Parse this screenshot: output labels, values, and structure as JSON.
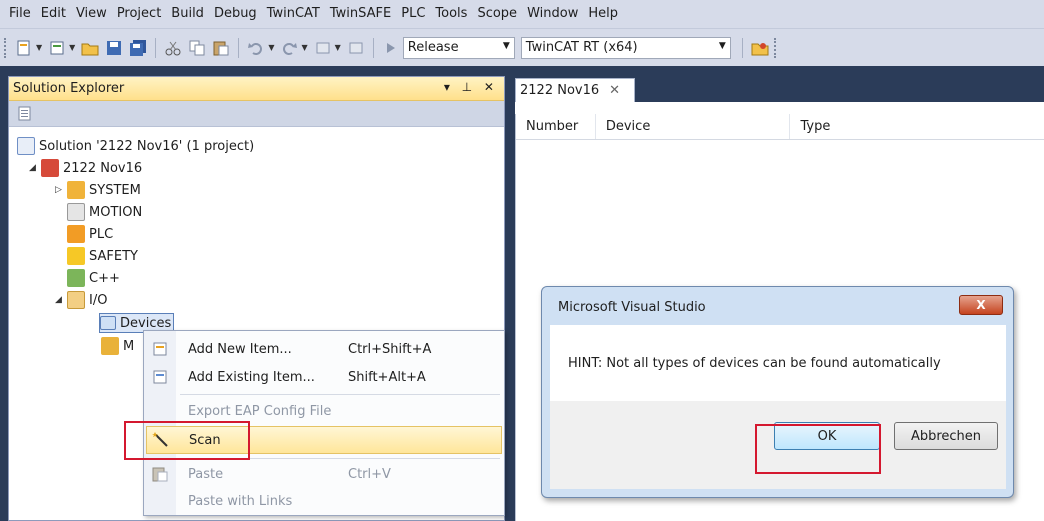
{
  "menu": [
    "File",
    "Edit",
    "View",
    "Project",
    "Build",
    "Debug",
    "TwinCAT",
    "TwinSAFE",
    "PLC",
    "Tools",
    "Scope",
    "Window",
    "Help"
  ],
  "toolbar": {
    "config_value": "Release",
    "platform_value": "TwinCAT RT (x64)"
  },
  "solution_explorer": {
    "title": "Solution Explorer",
    "title_controls": "▾ ⊥ ✕",
    "tree": [
      {
        "label": "Solution '2122 Nov16' (1 project)"
      },
      {
        "label": "2122 Nov16"
      },
      {
        "label": "SYSTEM"
      },
      {
        "label": "MOTION"
      },
      {
        "label": "PLC"
      },
      {
        "label": "SAFETY"
      },
      {
        "label": "C++"
      },
      {
        "label": "I/O"
      },
      {
        "label": "Devices"
      },
      {
        "label": "M"
      }
    ]
  },
  "document": {
    "tab_label": "2122 Nov16",
    "columns": [
      "Number",
      "Device",
      "Type"
    ]
  },
  "context_menu": {
    "items": [
      {
        "label": "Add New Item...",
        "shortcut": "Ctrl+Shift+A"
      },
      {
        "label": "Add Existing Item...",
        "shortcut": "Shift+Alt+A"
      },
      {
        "label": "Export EAP Config File",
        "shortcut": ""
      },
      {
        "label": "Scan",
        "shortcut": ""
      },
      {
        "label": "Paste",
        "shortcut": "Ctrl+V"
      },
      {
        "label": "Paste with Links",
        "shortcut": ""
      }
    ]
  },
  "dialog": {
    "title": "Microsoft Visual Studio",
    "close_glyph": "X",
    "message": "HINT: Not all types of devices can be found automatically",
    "ok_label": "OK",
    "cancel_label": "Abbrechen"
  },
  "colors": {
    "highlight_box": "#d4182f",
    "menu_highlight": "#ffe69a"
  }
}
